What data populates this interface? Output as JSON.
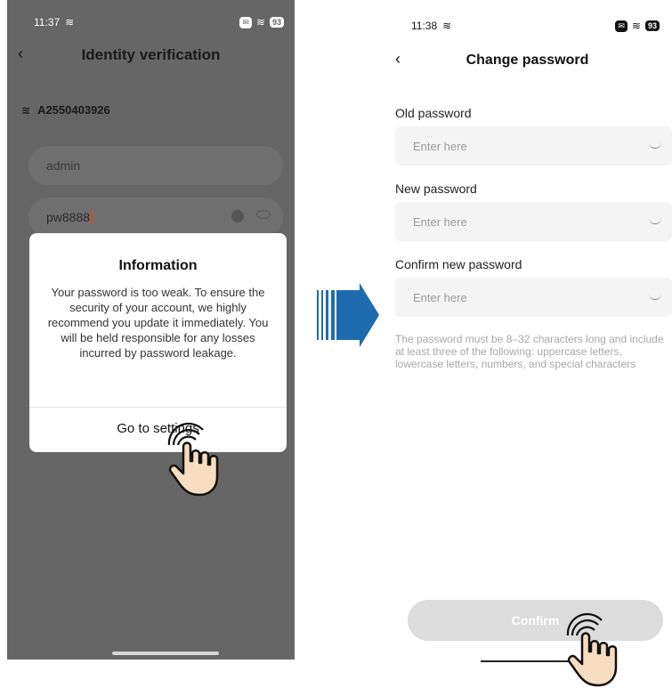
{
  "left": {
    "status_time": "11:37",
    "battery": "93",
    "title": "Identity verification",
    "device_name": "A2550403926",
    "username": "admin",
    "password": "pw8888",
    "modal": {
      "title": "Information",
      "body": "Your password is too weak. To ensure the security of your account, we highly recommend you update it immediately. You will be held responsible for any losses incurred by password leakage.",
      "button": "Go to settings"
    }
  },
  "right": {
    "status_time": "11:38",
    "battery": "93",
    "title": "Change password",
    "fields": [
      {
        "label": "Old password",
        "placeholder": "Enter here"
      },
      {
        "label": "New password",
        "placeholder": "Enter here"
      },
      {
        "label": "Confirm new password",
        "placeholder": "Enter here"
      }
    ],
    "hint": "The password must be 8–32 characters long and include at least three of the following: uppercase letters, lowercase letters, numbers, and special characters",
    "confirm_label": "Confirm"
  },
  "colors": {
    "arrow": "#1f6bb0",
    "overlay": "#666666",
    "hand": "#f7dcc0"
  }
}
